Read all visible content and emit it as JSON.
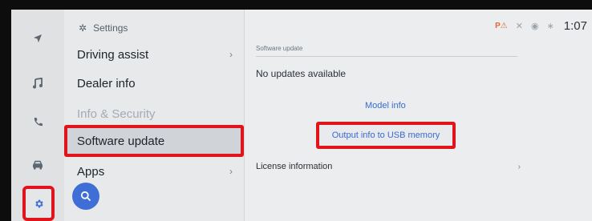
{
  "header": {
    "title": "Settings",
    "icon": "gear-icon"
  },
  "rail": {
    "icons": [
      "navigation-icon",
      "music-icon",
      "phone-icon",
      "car-icon",
      "settings-gear-icon"
    ]
  },
  "menu": {
    "items": [
      {
        "label": "Driving assist",
        "chevron": "›"
      },
      {
        "label": "Dealer info",
        "chevron": ""
      },
      {
        "label": "Info & Security",
        "chevron": ""
      },
      {
        "label": "Software update",
        "chevron": ""
      },
      {
        "label": "Apps",
        "chevron": "›"
      }
    ]
  },
  "status": {
    "time": "1:07"
  },
  "content": {
    "section_label": "Software update",
    "status_text": "No updates available",
    "model_info": "Model info",
    "output_usb": "Output info to USB memory",
    "license": "License information",
    "license_chevron": "›"
  },
  "colors": {
    "highlight": "#e1131b",
    "link": "#3a6bd0",
    "fab": "#3f6fd6"
  }
}
